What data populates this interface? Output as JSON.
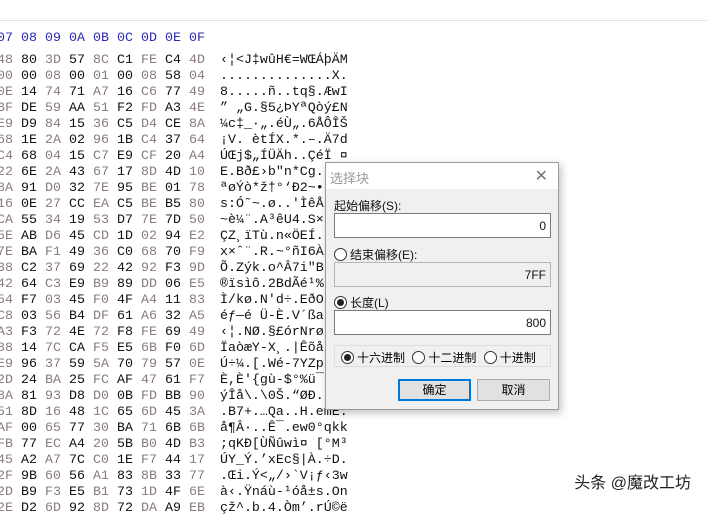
{
  "header": {
    "columns": [
      "07",
      "08",
      "09",
      "0A",
      "0B",
      "0C",
      "0D",
      "0E",
      "0F"
    ]
  },
  "rows": [
    {
      "hex": [
        "48",
        "80",
        "3D",
        "57",
        "8C",
        "C1",
        "FE",
        "C4",
        "4D"
      ],
      "text": "‹¦<J‡wûH€=WŒÁþÄM"
    },
    {
      "hex": [
        "00",
        "00",
        "08",
        "00",
        "01",
        "00",
        "08",
        "58",
        "04"
      ],
      "text": "..............X."
    },
    {
      "hex": [
        "0E",
        "14",
        "74",
        "71",
        "A7",
        "16",
        "C6",
        "77",
        "49"
      ],
      "text": "8.....ñ..tq§.ÆwI"
    },
    {
      "hex": [
        "BF",
        "DE",
        "59",
        "AA",
        "51",
        "F2",
        "FD",
        "A3",
        "4E"
      ],
      "text": "” „G.§5¿ÞYªQòý£N"
    },
    {
      "hex": [
        "E9",
        "D9",
        "84",
        "15",
        "36",
        "C5",
        "D4",
        "CE",
        "8A"
      ],
      "text": "¼c‡_·„.éÙ„.6ÅÔÎŠ"
    },
    {
      "hex": [
        "68",
        "1E",
        "2A",
        "02",
        "96",
        "1B",
        "C4",
        "37",
        "64"
      ],
      "text": "¡V. ètÍX.*.–.Ä7d"
    },
    {
      "hex": [
        "C4",
        "68",
        "04",
        "15",
        "C7",
        "E9",
        "CF",
        "20",
        "A4"
      ],
      "text": "ÚŒj$„ÍÜÄh..ÇéÏ ¤"
    },
    {
      "hex": [
        "22",
        "6E",
        "2A",
        "43",
        "67",
        "17",
        "8D",
        "4D",
        "10"
      ],
      "text": "E.Bð£›b\"n*Cg."
    },
    {
      "hex": [
        "8A",
        "91",
        "D0",
        "32",
        "7E",
        "95",
        "BE",
        "01",
        "78"
      ],
      "text": "ªøÝò*ž†°‘Ð2~•"
    },
    {
      "hex": [
        "16",
        "0E",
        "27",
        "CC",
        "EA",
        "C5",
        "BE",
        "B5",
        "80"
      ],
      "text": "s:Ó˜~.ø..'ÌêÅ"
    },
    {
      "hex": [
        "CA",
        "55",
        "34",
        "19",
        "53",
        "D7",
        "7E",
        "7D",
        "50"
      ],
      "text": "~è¼¨.A³êU4.S×"
    },
    {
      "hex": [
        "5E",
        "AB",
        "D6",
        "45",
        "CD",
        "1D",
        "02",
        "94",
        "E2"
      ],
      "text": "ÇZ¸ïTù.n«ÖEÍ."
    },
    {
      "hex": [
        "7E",
        "BA",
        "F1",
        "49",
        "36",
        "C0",
        "68",
        "70",
        "F9"
      ],
      "text": "x×ˆ¨.R.~°ñI6À"
    },
    {
      "hex": [
        "38",
        "C2",
        "37",
        "69",
        "22",
        "42",
        "92",
        "F3",
        "9D"
      ],
      "text": "Õ.Zýk.o^Â7i\"B"
    },
    {
      "hex": [
        "42",
        "64",
        "C3",
        "E9",
        "B9",
        "89",
        "DD",
        "06",
        "E5"
      ],
      "text": "®ïsìô.2BdÃé¹%"
    },
    {
      "hex": [
        "54",
        "F7",
        "03",
        "45",
        "F0",
        "4F",
        "A4",
        "11",
        "83"
      ],
      "text": "Ì/kø.N'd÷.EðO"
    },
    {
      "hex": [
        "C8",
        "03",
        "56",
        "B4",
        "DF",
        "61",
        "A6",
        "32",
        "A5"
      ],
      "text": "éƒ—é Ü-È.V´ßa"
    },
    {
      "hex": [
        "A3",
        "F3",
        "72",
        "4E",
        "72",
        "F8",
        "FE",
        "69",
        "49"
      ],
      "text": "‹¦.NØ.§£órNrø"
    },
    {
      "hex": [
        "88",
        "14",
        "7C",
        "CA",
        "F5",
        "E5",
        "6B",
        "F0",
        "6D"
      ],
      "text": "ÏaòæY-X¸.|Êõå"
    },
    {
      "hex": [
        "E9",
        "96",
        "37",
        "59",
        "5A",
        "70",
        "79",
        "57",
        "0E"
      ],
      "text": "Ú÷¼.[.Wé-7YZp"
    },
    {
      "hex": [
        "2D",
        "24",
        "BA",
        "25",
        "FC",
        "AF",
        "47",
        "61",
        "F7"
      ],
      "text": "È,È'{gù-$°%ü¯"
    },
    {
      "hex": [
        "8A",
        "81",
        "93",
        "D8",
        "D0",
        "0B",
        "FD",
        "BB",
        "90"
      ],
      "text": "ýÎå\\.\\0Š.“ØÐ."
    },
    {
      "hex": [
        "51",
        "8D",
        "16",
        "48",
        "1C",
        "65",
        "6D",
        "45",
        "3A"
      ],
      "text": ".B7+.…Qa..H.emE:"
    },
    {
      "hex": [
        "AF",
        "00",
        "65",
        "77",
        "30",
        "BA",
        "71",
        "6B",
        "6B"
      ],
      "text": "å¶Â·..Ê¯.ew0°qkk"
    },
    {
      "hex": [
        "FB",
        "77",
        "EC",
        "A4",
        "20",
        "5B",
        "B0",
        "4D",
        "B3"
      ],
      "text": ";qKÐ[ÙÑûwì¤ [°M³"
    },
    {
      "hex": [
        "45",
        "A2",
        "A7",
        "7C",
        "C0",
        "1E",
        "F7",
        "44",
        "17"
      ],
      "text": "ÚY_Ý.’xEc§|À.÷D."
    },
    {
      "hex": [
        "2F",
        "9B",
        "60",
        "56",
        "A1",
        "83",
        "8B",
        "33",
        "77"
      ],
      "text": ".Œi.Ý<„/›`V¡ƒ‹3w"
    },
    {
      "hex": [
        "2D",
        "B9",
        "F3",
        "E5",
        "B1",
        "73",
        "1D",
        "4F",
        "6E"
      ],
      "text": "à‹.Ÿnáù-¹óå±s.On"
    },
    {
      "hex": [
        "2E",
        "D2",
        "6D",
        "92",
        "8D",
        "72",
        "DA",
        "A9",
        "EB"
      ],
      "text": "çž^.b.4.Òm’.rÚ©ë"
    }
  ],
  "dialog": {
    "title": "选择块",
    "start_label": "起始偏移(S):",
    "start_value": "0",
    "end_label": "结束偏移(E):",
    "end_value": "7FF",
    "length_label": "长度(L)",
    "length_value": "800",
    "bases": [
      "十六进制",
      "十二进制",
      "十进制"
    ],
    "ok": "确定",
    "cancel": "取消"
  },
  "watermark": "头条 @魔改工坊"
}
